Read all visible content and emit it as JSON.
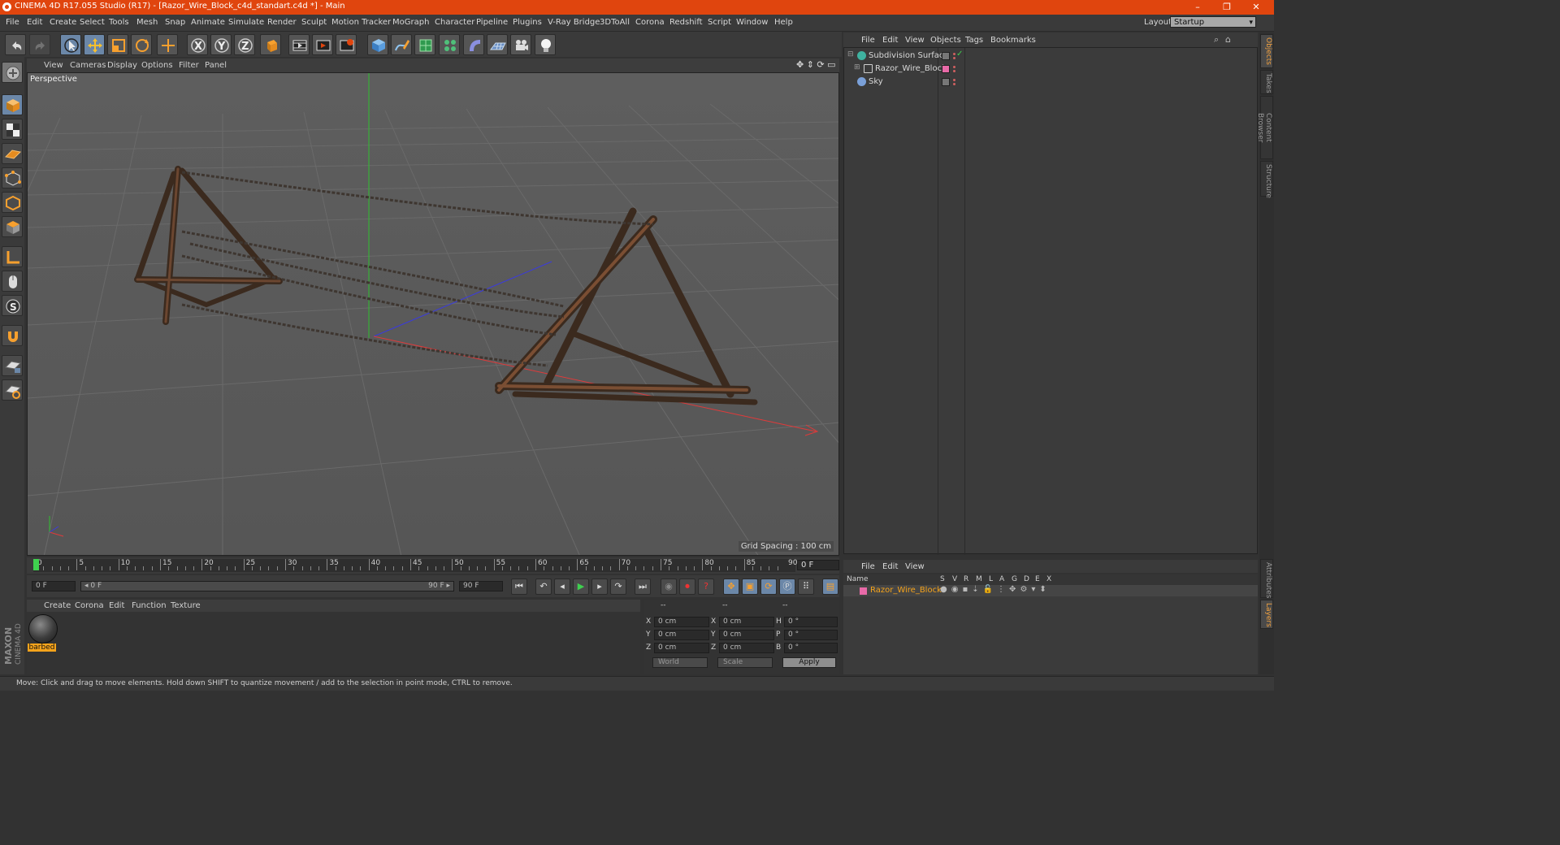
{
  "window": {
    "title": "CINEMA 4D R17.055 Studio (R17) - [Razor_Wire_Block_c4d_standart.c4d *] - Main",
    "minimize": "–",
    "restore": "❐",
    "close": "✕"
  },
  "menu": [
    "File",
    "Edit",
    "Create",
    "Select",
    "Tools",
    "Mesh",
    "Snap",
    "Animate",
    "Simulate",
    "Render",
    "Sculpt",
    "Motion Tracker",
    "MoGraph",
    "Character",
    "Pipeline",
    "Plugins",
    "V-Ray Bridge",
    "3DToAll",
    "Corona",
    "Redshift",
    "Script",
    "Window",
    "Help"
  ],
  "layout": {
    "label": "Layout:",
    "value": "Startup"
  },
  "viewport": {
    "menu": [
      "View",
      "Cameras",
      "Display",
      "Options",
      "Filter",
      "Panel"
    ],
    "label": "Perspective",
    "grid_spacing": "Grid Spacing : 100 cm"
  },
  "timeline": {
    "ticks": [
      "0",
      "5",
      "10",
      "15",
      "20",
      "25",
      "30",
      "35",
      "40",
      "45",
      "50",
      "55",
      "60",
      "65",
      "70",
      "75",
      "80",
      "85",
      "90"
    ],
    "current_frame": "0 F",
    "start_field": "0 F",
    "range_start": "◂ 0 F",
    "range_end": "90 F ▸",
    "end_field": "90 F"
  },
  "material": {
    "menu": [
      "Create",
      "Corona",
      "Edit",
      "Function",
      "Texture"
    ],
    "name": "barbed"
  },
  "coords": {
    "head": [
      "--",
      "--",
      "--"
    ],
    "rows": [
      {
        "a": "X",
        "av": "0 cm",
        "b": "X",
        "bv": "0 cm",
        "c": "H",
        "cv": "0 °"
      },
      {
        "a": "Y",
        "av": "0 cm",
        "b": "Y",
        "bv": "0 cm",
        "c": "P",
        "cv": "0 °"
      },
      {
        "a": "Z",
        "av": "0 cm",
        "b": "Z",
        "bv": "0 cm",
        "c": "B",
        "cv": "0 °"
      }
    ],
    "world": "World",
    "scale": "Scale",
    "apply": "Apply"
  },
  "status": "Move: Click and drag to move elements. Hold down SHIFT to quantize movement / add to the selection in point mode, CTRL to remove.",
  "object_manager": {
    "menu": [
      "File",
      "Edit",
      "View",
      "Objects",
      "Tags",
      "Bookmarks"
    ],
    "objects": [
      {
        "name": "Subdivision Surface",
        "icon_color": "#3fb2a0"
      },
      {
        "name": "Razor_Wire_Block",
        "icon_color": "#cfcfcf"
      },
      {
        "name": "Sky",
        "icon_color": "#7aa0d8"
      }
    ]
  },
  "layer_manager": {
    "menu": [
      "File",
      "Edit",
      "View"
    ],
    "columns": [
      "Name",
      "S",
      "V",
      "R",
      "M",
      "L",
      "A",
      "G",
      "D",
      "E",
      "X"
    ],
    "layer": "Razor_Wire_Block",
    "layer_color": "#e86aa8"
  },
  "right_tabs": [
    "Objects",
    "Takes",
    "Content Browser",
    "Structure"
  ],
  "right_tabs_bottom": [
    "Attributes",
    "Layers"
  ],
  "brand": {
    "maxon": "MAXON",
    "product": "CINEMA 4D"
  },
  "colors": {
    "accent": "#e0450e",
    "selection": "#f5a31b"
  }
}
